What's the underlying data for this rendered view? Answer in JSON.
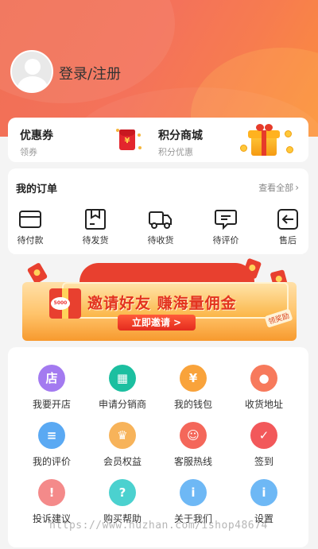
{
  "header": {
    "login_label": "登录/注册"
  },
  "promo": {
    "coupon": {
      "title": "优惠券",
      "subtitle": "领券",
      "icon": "red-envelope-icon"
    },
    "points_mall": {
      "title": "积分商城",
      "subtitle": "积分优惠",
      "icon": "gift-box-icon"
    }
  },
  "orders": {
    "title": "我的订单",
    "view_all": "查看全部",
    "items": [
      {
        "label": "待付款",
        "icon": "wallet-icon"
      },
      {
        "label": "待发货",
        "icon": "package-icon"
      },
      {
        "label": "待收货",
        "icon": "truck-icon"
      },
      {
        "label": "待评价",
        "icon": "comment-icon"
      },
      {
        "label": "售后",
        "icon": "return-icon"
      }
    ]
  },
  "banner": {
    "headline": "邀请好友 赚海量佣金",
    "cta": "立即邀请 >",
    "coin_text": "5000",
    "tag": "领奖励"
  },
  "services": [
    {
      "label": "我要开店",
      "icon": "store-icon",
      "color": "#a37af0",
      "glyph": "店"
    },
    {
      "label": "申请分销商",
      "icon": "building-icon",
      "color": "#1cbfa0",
      "glyph": "▦"
    },
    {
      "label": "我的钱包",
      "icon": "wallet-yen-icon",
      "color": "#f9a33b",
      "glyph": "¥"
    },
    {
      "label": "收货地址",
      "icon": "location-icon",
      "color": "#f77a5c",
      "glyph": "●"
    },
    {
      "label": "我的评价",
      "icon": "document-icon",
      "color": "#5aa9f3",
      "glyph": "≡"
    },
    {
      "label": "会员权益",
      "icon": "crown-icon",
      "color": "#f7b35a",
      "glyph": "♛"
    },
    {
      "label": "客服热线",
      "icon": "headset-icon",
      "color": "#f4675a",
      "glyph": "☺"
    },
    {
      "label": "签到",
      "icon": "calendar-icon",
      "color": "#f2585a",
      "glyph": "✓"
    },
    {
      "label": "投诉建议",
      "icon": "warning-icon",
      "color": "#f48a8a",
      "glyph": "!"
    },
    {
      "label": "购买帮助",
      "icon": "question-icon",
      "color": "#4bd1cf",
      "glyph": "?"
    },
    {
      "label": "关于我们",
      "icon": "info-icon",
      "color": "#6eb8f5",
      "glyph": "i"
    },
    {
      "label": "设置",
      "icon": "info-icon-2",
      "color": "#6eb8f5",
      "glyph": "i"
    }
  ],
  "watermark": "https://www.huzhan.com/ishop48674"
}
